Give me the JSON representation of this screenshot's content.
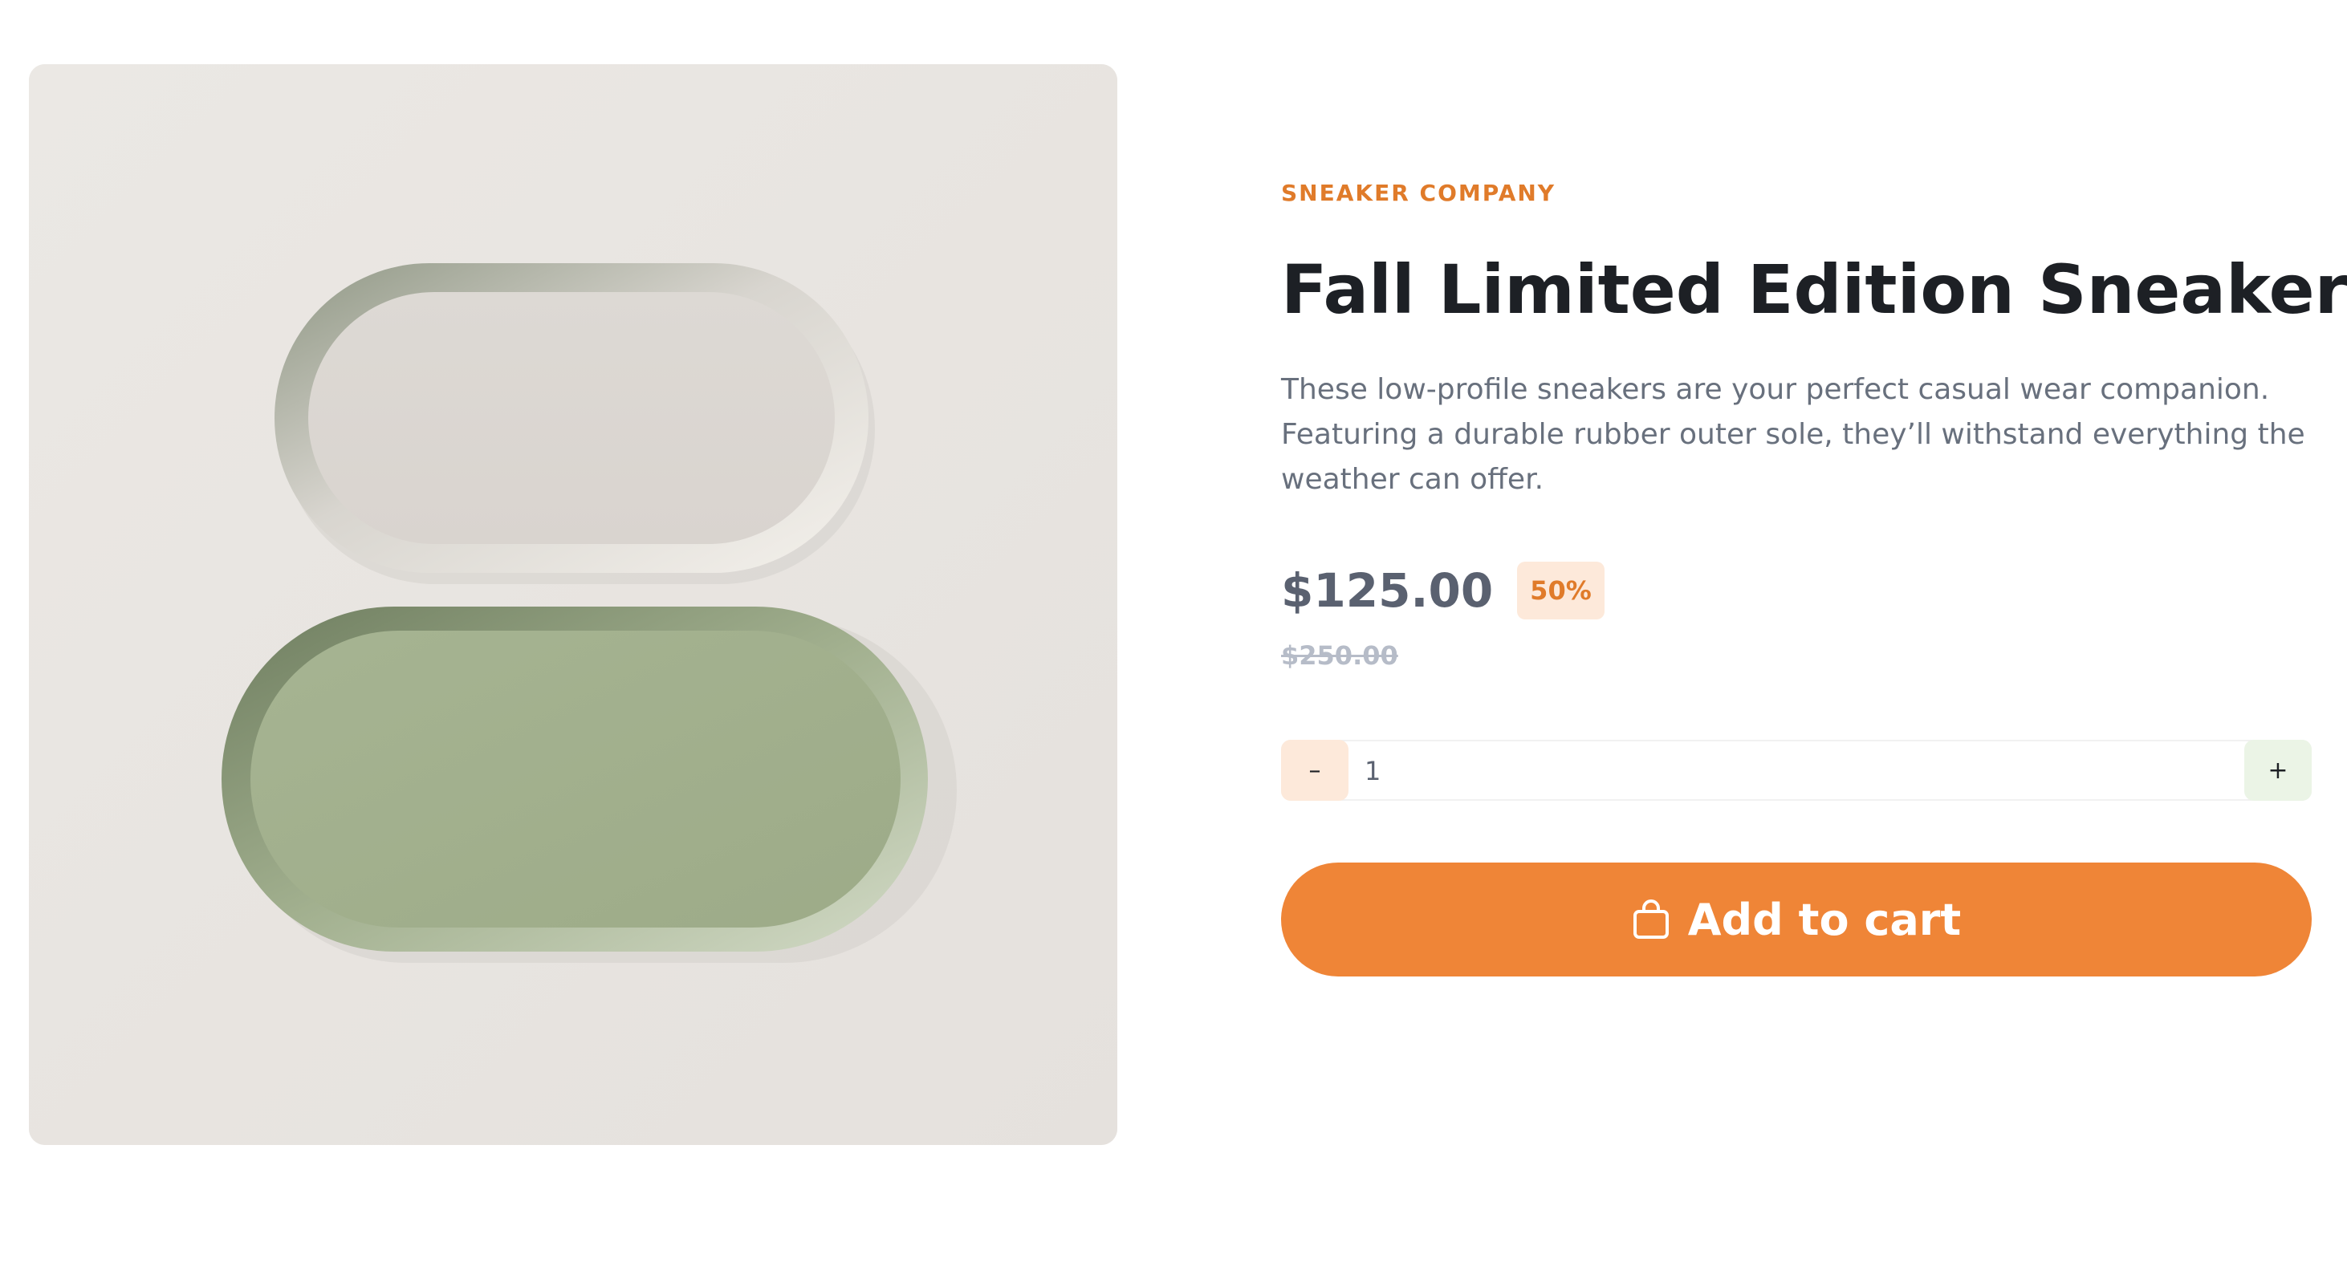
{
  "product": {
    "image_alt": "Two oval trays, one cream and one sage green",
    "company": "SNEAKER COMPANY",
    "title": "Fall Limited Edition Sneakers",
    "description": "These low-profile sneakers are your perfect casual wear companion. Featuring a durable rubber outer sole, they’ll withstand everything the weather can offer.",
    "price": "$125.00",
    "discount": "50%",
    "original_price": "$250.00"
  },
  "quantity": {
    "value": "1",
    "minus_label": "–",
    "plus_label": "+"
  },
  "cart_button": {
    "label": "Add to cart",
    "icon": "shopping-bag-icon"
  },
  "colors": {
    "accent": "#EF8537",
    "accent_text": "#E07B2A",
    "accent_soft": "#FDE9DA",
    "plus_soft": "#EBF4E6",
    "heading": "#1D2025",
    "body_text": "#68707D",
    "price_text": "#5A6170",
    "strike_text": "#B6BCC8"
  }
}
